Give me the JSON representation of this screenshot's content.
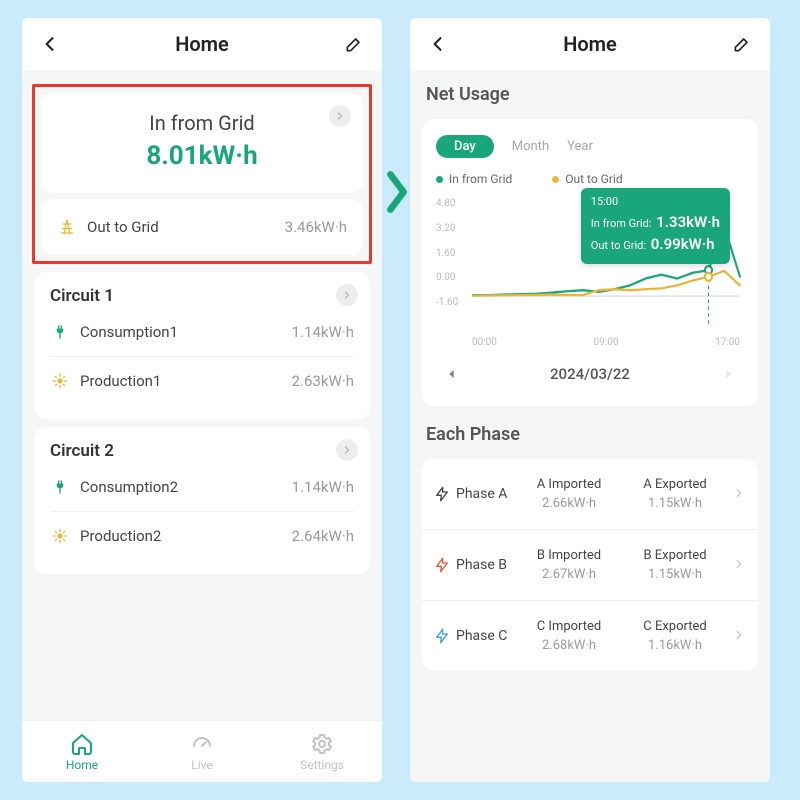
{
  "left": {
    "title": "Home",
    "hero": {
      "label": "In from Grid",
      "value": "8.01kW·h"
    },
    "out_to_grid": {
      "label": "Out to Grid",
      "value": "3.46kW·h"
    },
    "circuits": [
      {
        "title": "Circuit 1",
        "rows": [
          {
            "icon": "plug",
            "label": "Consumption1",
            "value": "1.14kW·h"
          },
          {
            "icon": "sun",
            "label": "Production1",
            "value": "2.63kW·h"
          }
        ]
      },
      {
        "title": "Circuit 2",
        "rows": [
          {
            "icon": "plug",
            "label": "Consumption2",
            "value": "1.14kW·h"
          },
          {
            "icon": "sun",
            "label": "Production2",
            "value": "2.64kW·h"
          }
        ]
      }
    ],
    "tabs": [
      {
        "label": "Home",
        "active": true
      },
      {
        "label": "Live",
        "active": false
      },
      {
        "label": "Settings",
        "active": false
      }
    ]
  },
  "right": {
    "title": "Home",
    "net_usage_title": "Net Usage",
    "ranges": {
      "active": "Day",
      "month": "Month",
      "year": "Year"
    },
    "legend": {
      "in": "In from Grid",
      "out": "Out to Grid"
    },
    "colors": {
      "in": "#19a67a",
      "out": "#e9b63a"
    },
    "tooltip": {
      "time": "15:00",
      "in_label": "In from Grid:",
      "in_value": "1.33kW·h",
      "out_label": "Out to Grid:",
      "out_value": "0.99kW·h"
    },
    "date": "2024/03/22",
    "each_phase_title": "Each Phase",
    "phases": [
      {
        "name": "Phase A",
        "color": "#444",
        "im_label": "A Imported",
        "im_val": "2.66kW·h",
        "ex_label": "A Exported",
        "ex_val": "1.15kW·h"
      },
      {
        "name": "Phase B",
        "color": "#e05a3a",
        "im_label": "B Imported",
        "im_val": "2.67kW·h",
        "ex_label": "B Exported",
        "ex_val": "1.15kW·h"
      },
      {
        "name": "Phase C",
        "color": "#3aa0e0",
        "im_label": "C Imported",
        "im_val": "2.68kW·h",
        "ex_label": "C Exported",
        "ex_val": "1.16kW·h"
      }
    ]
  },
  "chart_data": {
    "type": "line",
    "xlabel": "",
    "ylabel": "",
    "x_ticks": [
      "00:00",
      "09:00",
      "17:00"
    ],
    "y_ticks": [
      4.8,
      3.2,
      1.6,
      0.0,
      -1.6
    ],
    "ylim": [
      -1.6,
      4.8
    ],
    "series": [
      {
        "name": "In from Grid",
        "color": "#19a67a",
        "values": [
          0.05,
          0.05,
          0.08,
          0.1,
          0.12,
          0.18,
          0.25,
          0.3,
          0.22,
          0.35,
          0.55,
          0.9,
          1.1,
          0.9,
          1.2,
          1.33,
          3.6,
          1.0
        ]
      },
      {
        "name": "Out to Grid",
        "color": "#e9b63a",
        "values": [
          0.02,
          0.03,
          0.04,
          0.05,
          0.06,
          0.08,
          0.06,
          0.05,
          0.3,
          0.35,
          0.3,
          0.35,
          0.4,
          0.55,
          0.8,
          0.99,
          1.3,
          0.55
        ]
      }
    ],
    "x_len": 18,
    "highlight_index": 15
  }
}
